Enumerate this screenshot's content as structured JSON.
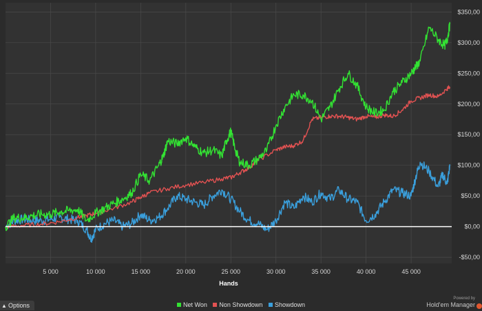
{
  "chart_data": {
    "type": "line",
    "xlabel": "Hands",
    "ylabel": "",
    "xlim": [
      0,
      49500
    ],
    "ylim": [
      -60,
      365
    ],
    "x_ticks": [
      5000,
      10000,
      15000,
      20000,
      25000,
      30000,
      35000,
      40000,
      45000
    ],
    "x_tick_labels": [
      "5 000",
      "10 000",
      "15 000",
      "20 000",
      "25 000",
      "30 000",
      "35 000",
      "40 000",
      "45 000"
    ],
    "y_ticks": [
      -50,
      0,
      50,
      100,
      150,
      200,
      250,
      300,
      350
    ],
    "y_tick_labels": [
      "-$50,00",
      "$0,00",
      "$50,00",
      "$100,00",
      "$150,00",
      "$200,00",
      "$250,00",
      "$300,00",
      "$350,00"
    ],
    "grid": true,
    "legend_position": "bottom-center",
    "series": [
      {
        "name": "Net Won",
        "color": "#33e233",
        "x": [
          0,
          1000,
          2000,
          3000,
          4000,
          5000,
          6000,
          7000,
          8000,
          9000,
          10000,
          11000,
          12000,
          13000,
          14000,
          15000,
          16000,
          17000,
          17500,
          18000,
          19000,
          20000,
          21000,
          22000,
          23000,
          24000,
          24500,
          25000,
          25500,
          26000,
          27000,
          28000,
          29000,
          30000,
          31000,
          32000,
          33000,
          34000,
          35000,
          36000,
          37000,
          38000,
          39000,
          40000,
          41000,
          42000,
          43000,
          44000,
          45000,
          45500,
          46000,
          47000,
          48000,
          48700,
          49000,
          49300
        ],
        "values": [
          0,
          15,
          14,
          18,
          20,
          20,
          24,
          26,
          28,
          10,
          22,
          30,
          38,
          45,
          55,
          85,
          75,
          100,
          115,
          140,
          135,
          145,
          130,
          120,
          125,
          115,
          140,
          155,
          125,
          105,
          100,
          110,
          125,
          165,
          195,
          215,
          215,
          205,
          175,
          195,
          225,
          250,
          230,
          195,
          185,
          190,
          220,
          235,
          250,
          260,
          270,
          325,
          305,
          295,
          305,
          330
        ]
      },
      {
        "name": "Non Showdown",
        "color": "#e25252",
        "x": [
          0,
          2000,
          4000,
          6000,
          8000,
          9000,
          10000,
          12000,
          14000,
          15000,
          16000,
          18000,
          20000,
          22000,
          24000,
          25000,
          26000,
          27000,
          28000,
          30000,
          31000,
          32000,
          33000,
          34000,
          35000,
          36000,
          37000,
          38000,
          39000,
          40000,
          41000,
          42000,
          43000,
          44000,
          45000,
          46000,
          47000,
          48000,
          49000,
          49300
        ],
        "values": [
          0,
          2,
          4,
          8,
          15,
          18,
          22,
          30,
          40,
          48,
          55,
          62,
          68,
          72,
          78,
          80,
          88,
          96,
          108,
          125,
          130,
          132,
          140,
          175,
          178,
          180,
          180,
          178,
          175,
          180,
          178,
          182,
          180,
          190,
          205,
          210,
          215,
          212,
          225,
          228
        ]
      },
      {
        "name": "Showdown",
        "color": "#3a9fdc",
        "x": [
          0,
          1000,
          2000,
          3000,
          4000,
          5000,
          6000,
          7000,
          8000,
          9000,
          9500,
          10000,
          11000,
          12000,
          13000,
          14000,
          15000,
          16000,
          17000,
          18000,
          19000,
          20000,
          21000,
          22000,
          23000,
          24000,
          25000,
          26000,
          27000,
          28000,
          29000,
          30000,
          31000,
          32000,
          33000,
          34000,
          35000,
          36000,
          37000,
          38000,
          39000,
          40000,
          41000,
          42000,
          43000,
          44000,
          45000,
          45500,
          46000,
          47000,
          48000,
          48500,
          49000,
          49300
        ],
        "values": [
          0,
          10,
          12,
          10,
          10,
          12,
          15,
          12,
          10,
          -5,
          -20,
          -5,
          5,
          10,
          0,
          5,
          20,
          10,
          15,
          30,
          50,
          45,
          40,
          35,
          50,
          60,
          45,
          25,
          10,
          5,
          -5,
          10,
          40,
          30,
          50,
          40,
          55,
          45,
          60,
          45,
          40,
          10,
          20,
          40,
          60,
          55,
          50,
          80,
          105,
          90,
          65,
          85,
          70,
          100
        ]
      }
    ]
  },
  "ui": {
    "options_label": "Options",
    "powered_by": "Powered by",
    "brand": "Hold'em Manager"
  },
  "colors": {
    "background": "#2b2b2b",
    "plot_background": "#323232",
    "grid": "#4a4a4a",
    "zero_line": "#ffffff"
  }
}
